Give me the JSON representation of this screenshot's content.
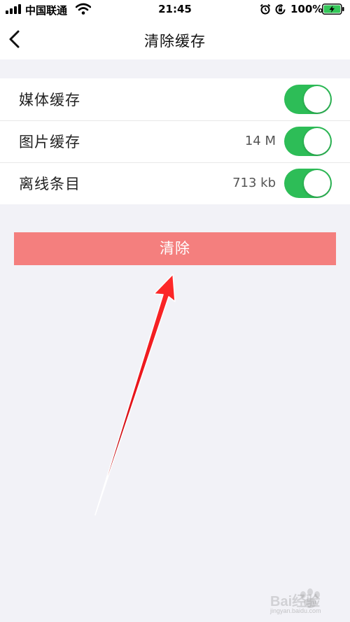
{
  "status_bar": {
    "carrier": "中国联通",
    "time": "21:45",
    "battery_percent": "100%",
    "battery_level": 1.0,
    "icons": [
      "signal-icon",
      "wifi-icon",
      "alarm-icon",
      "rotation-lock-icon",
      "battery-charging-icon"
    ]
  },
  "nav": {
    "back_icon": "chevron-left-icon",
    "title": "清除缓存"
  },
  "cache_items": [
    {
      "label": "媒体缓存",
      "value": "",
      "enabled": true
    },
    {
      "label": "图片缓存",
      "value": "14 M",
      "enabled": true
    },
    {
      "label": "离线条目",
      "value": "713 kb",
      "enabled": true
    }
  ],
  "clear_button": {
    "label": "清除"
  },
  "watermark": {
    "text": "Bai经验",
    "subtext": "jingyan.baidu.com"
  },
  "colors": {
    "toggle_on": "#2dbd57",
    "clear_button": "#f47f7e",
    "page_background": "#f2f2f7",
    "annotation_arrow": "#e8141b"
  }
}
